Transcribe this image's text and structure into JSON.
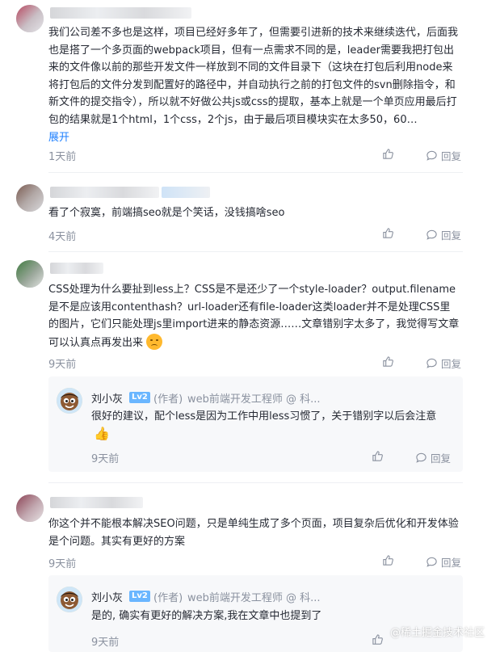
{
  "comments": [
    {
      "text": "我们公司差不多也是这样，项目已经好多年了，但需要引进新的技术来继续迭代，后面我也是搭了一个多页面的webpack项目，但有一点需求不同的是，leader需要我把打包出来的文件像以前的那些开发文件一样放到不同的文件目录下（这块在打包后利用node来将打包后的文件分发到配置好的路径中，并自动执行之前的打包文件的svn删除指令，和新文件的提交指令），所以就不好做公共js或css的提取，基本上就是一个单页应用最后打包的结果就是1个html，1个css，2个js，由于最后项目模块实在太多50，60…",
      "expand": "展开",
      "time": "1天前",
      "reply": "回复"
    },
    {
      "text": "看了个寂寞，前端搞seo就是个笑话，没钱搞啥seo",
      "time": "4天前",
      "reply": "回复"
    },
    {
      "text": "CSS处理为什么要扯到less上？CSS是不是还少了一个style-loader？output.filename是不是应该用contenthash？url-loader还有file-loader这类loader并不是处理CSS里的图片，它们只能处理js里import进来的静态资源……文章错别字太多了，我觉得写文章可以认真点再发出来",
      "time": "9天前",
      "reply": "回复",
      "sub": {
        "name": "刘小灰",
        "level": "Lv2",
        "author": "(作者)",
        "title": "web前端开发工程师 @ 科...",
        "text": "很好的建议，配个less是因为工作中用less习惯了，关于错别字以后会注意",
        "time": "9天前",
        "reply": "回复"
      }
    },
    {
      "text": "你这个并不能根本解决SEO问题，只是单纯生成了多个页面，项目复杂后优化和开发体验是个问题。其实有更好的方案",
      "time": "9天前",
      "reply": "回复",
      "sub": {
        "name": "刘小灰",
        "level": "Lv2",
        "author": "(作者)",
        "title": "web前端开发工程师 @ 科...",
        "text": "是的, 确实有更好的解决方案,我在文章中也提到了",
        "time": "9天前",
        "reply": "回复"
      }
    }
  ],
  "watermark": "@稀土掘金技术社区"
}
